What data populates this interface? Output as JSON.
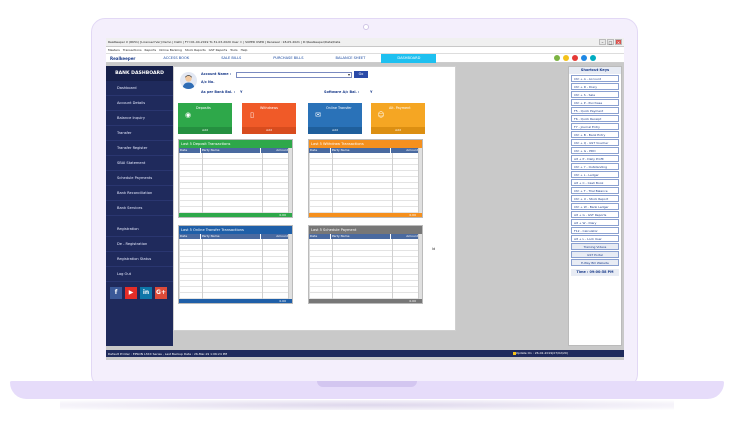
{
  "window": {
    "title": "RealKeeper X (RK51) [Licensed Ver] Demo | Delhi | FY=01-04-2019 To 31-03-2020 User = | SUPER USER | Renewal : 18-05-2021 | D:\\Realkeeper\\Data\\Data"
  },
  "menu": [
    "Masters",
    "Transactions",
    "Reports",
    "Online Banking",
    "Stock Reports",
    "GST Reports",
    "Tools",
    "Help"
  ],
  "tabs": {
    "brand": "Realkeeper",
    "items": [
      "ACCESS BOOK",
      "SALE BILLS",
      "PURCHASE BILLS",
      "BALANCE SHEET",
      "DASHBOARD"
    ],
    "active": "DASHBOARD"
  },
  "tab_icon_colors": [
    "#7cb342",
    "#f4c21a",
    "#e53935",
    "#1e88e5",
    "#00acc1"
  ],
  "sidebar": {
    "title": "BANK DASHBOARD",
    "items": [
      "Dashboard",
      "Account Details",
      "Balance Inquiry",
      "Transfer",
      "Transfer Register",
      "SBAI Statement",
      "Schedule Payments",
      "Bank Reconciliation",
      "Bank Services"
    ],
    "items2": [
      "Registration",
      "De - Registration",
      "Registration Status",
      "Log Out"
    ],
    "social": [
      {
        "icon": "facebook-icon",
        "glyph": "f",
        "color": "#3b5998"
      },
      {
        "icon": "youtube-icon",
        "glyph": "▶",
        "color": "#e52d27"
      },
      {
        "icon": "linkedin-icon",
        "glyph": "in",
        "color": "#0e76a8"
      },
      {
        "icon": "googleplus-icon",
        "glyph": "G+",
        "color": "#dd4b39"
      }
    ]
  },
  "account": {
    "account_label": "Account Name :",
    "ac_no_label": "A/c No.",
    "bank_bal_label": "As per Bank Bal. :",
    "bank_bal_value": "Y",
    "software_bal_label": "Software A/c Bal. :",
    "software_bal_value": "Y",
    "go_label": "Go"
  },
  "cards": [
    {
      "title": "Deposits",
      "foot": "Add",
      "color": "#2ea84a",
      "footcolor": "#259040",
      "icon": "deposit-icon",
      "glyph": "◉"
    },
    {
      "title": "Withdraws",
      "foot": "Add",
      "color": "#f05a28",
      "footcolor": "#d84c1e",
      "icon": "mobile-icon",
      "glyph": "▯"
    },
    {
      "title": "Online Transfer",
      "foot": "Add",
      "color": "#2a72b8",
      "footcolor": "#1f5f9c",
      "icon": "chat-icon",
      "glyph": "✉"
    },
    {
      "title": "Alt. Payment",
      "foot": "Add",
      "color": "#f5a623",
      "footcolor": "#dc8f12",
      "icon": "users-icon",
      "glyph": "☺"
    }
  ],
  "panels": [
    {
      "title": "Last 5 Deposit Transactions",
      "color": "#2ea84a",
      "cols": [
        "Date",
        "Party Name",
        "Amount"
      ],
      "foot": "0.00"
    },
    {
      "title": "Last 5 Withdraw Transactions",
      "color": "#f5901e",
      "cols": [
        "Date",
        "Party Name",
        "Amount"
      ],
      "foot": "0.00"
    },
    {
      "title": "Last 5 Online Transfer Transactions",
      "color": "#1f5fa8",
      "cols": [
        "Date",
        "Party Name",
        "Amount"
      ],
      "foot": "0.00"
    },
    {
      "title": "Last 5 Schedule Payment",
      "color": "#777777",
      "cols": [
        "Date",
        "Party Name",
        "Amount"
      ],
      "foot": "0.00"
    }
  ],
  "mid_note": "Id",
  "shortcuts": {
    "title": "Shortcut Keys",
    "keys": [
      "Ctrl + A - Account",
      "Ctrl + D - Diary",
      "Ctrl + S - Sale",
      "Ctrl + P - Purchase",
      "F5 - Quick Payment",
      "F6 - Quick Receipt",
      "F7 - Journal Entry",
      "Ctrl + B - Bank Entry",
      "Ctrl + Q - GST Voucher",
      "Ctrl + G - PDD",
      "Alt + P - Daily Profit",
      "Ctrl + Y - Outstanding",
      "Ctrl + L - Ledger",
      "Alt + C - Cash Book",
      "Ctrl + T - Trial Balance",
      "Ctrl + U - Stock Report",
      "Ctrl + W - Bank Ledger",
      "Alt + G - GST Reports",
      "Alt + W - Diary",
      "F12 - Calculator",
      "Alt + L - Lock User"
    ],
    "links": [
      "Training Videos",
      "GST Portal",
      "E-Way Bill Website"
    ],
    "time": "Time : 09:00:58 PM"
  },
  "status": {
    "left": "Default Printer : EPSON L3XX Series , Last Backup Date : 26-Mar-19 1:06:24 PM",
    "right": "Update On : 26-02-2019(07/02/20)"
  }
}
